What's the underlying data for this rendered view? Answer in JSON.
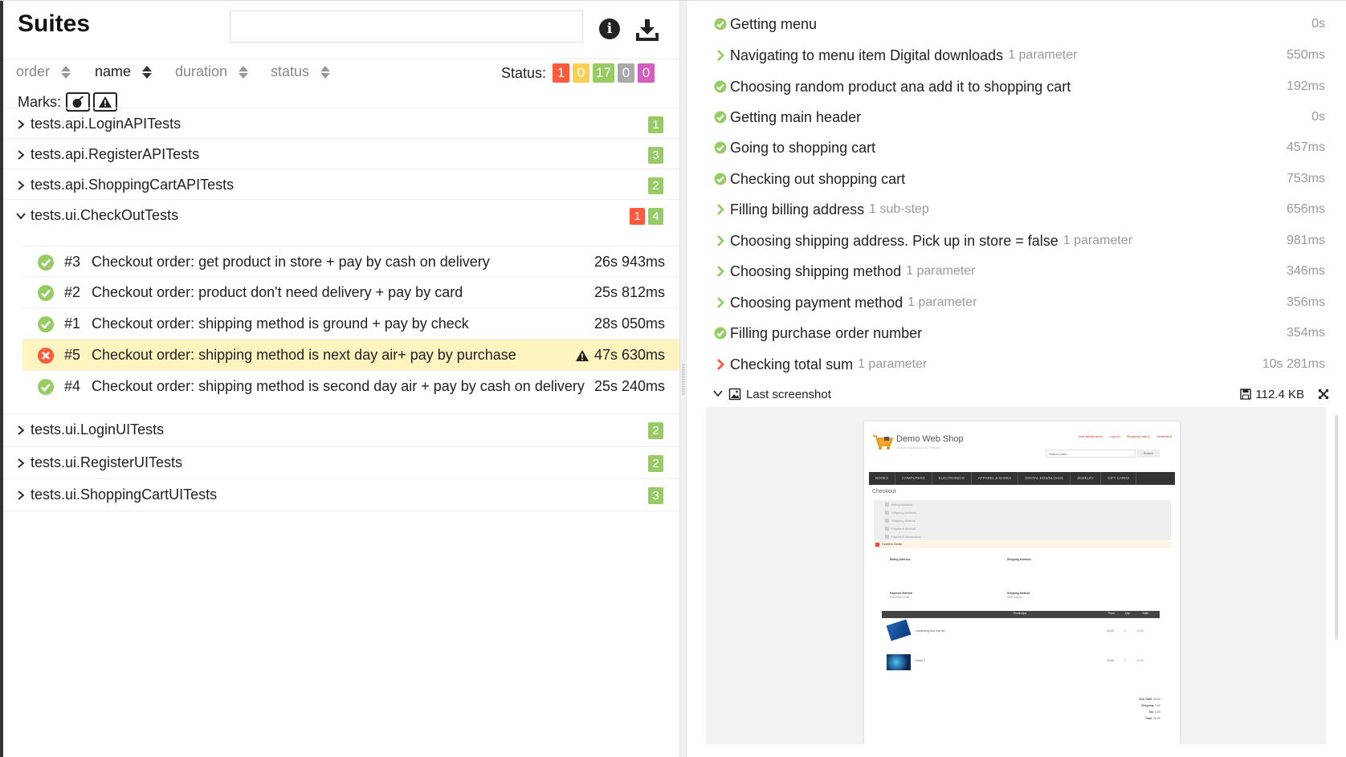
{
  "left": {
    "title": "Suites",
    "search": {
      "value": "",
      "placeholder": ""
    },
    "icons": {
      "info": "info-icon",
      "download": "download-icon"
    },
    "sort": [
      {
        "label": "order"
      },
      {
        "label": "name"
      },
      {
        "label": "duration"
      },
      {
        "label": "status"
      }
    ],
    "status_label": "Status:",
    "status_counts": [
      "1",
      "0",
      "17",
      "0",
      "0"
    ],
    "marks_label": "Marks:",
    "suites_before": [
      {
        "name": "tests.api.LoginAPITests",
        "passed": "1"
      },
      {
        "name": "tests.api.RegisterAPITests",
        "passed": "3"
      },
      {
        "name": "tests.api.ShoppingCartAPITests",
        "passed": "2"
      }
    ],
    "expanded_suite": {
      "name": "tests.ui.CheckOutTests",
      "failed": "1",
      "passed": "4"
    },
    "tests": [
      {
        "order": "#3",
        "name": "Checkout order: get product in store + pay by cash on delivery",
        "duration": "26s 943ms"
      },
      {
        "order": "#2",
        "name": "Checkout order: product don't need delivery + pay by card",
        "duration": "25s 812ms"
      },
      {
        "order": "#1",
        "name": "Checkout order: shipping method is ground + pay by check",
        "duration": "28s 050ms"
      },
      {
        "order": "#5",
        "name": "Checkout order: shipping method is next day air+ pay by purchase",
        "duration": "47s 630ms"
      },
      {
        "order": "#4",
        "name": "Checkout order: shipping method is second day air + pay by cash on delivery",
        "duration": "25s 240ms"
      }
    ],
    "suites_after": [
      {
        "name": "tests.ui.LoginUITests",
        "passed": "2"
      },
      {
        "name": "tests.ui.RegisterUITests",
        "passed": "2"
      },
      {
        "name": "tests.ui.ShoppingCartUITests",
        "passed": "3"
      }
    ]
  },
  "right": {
    "steps": [
      {
        "name": "Getting menu",
        "extra": "",
        "duration": "0s"
      },
      {
        "name": "Navigating to menu item Digital downloads",
        "extra": "1 parameter",
        "duration": "550ms"
      },
      {
        "name": "Choosing random product ana add it to shopping cart",
        "extra": "",
        "duration": "192ms"
      },
      {
        "name": "Getting main header",
        "extra": "",
        "duration": "0s"
      },
      {
        "name": "Going to shopping cart",
        "extra": "",
        "duration": "457ms"
      },
      {
        "name": "Checking out shopping cart",
        "extra": "",
        "duration": "753ms"
      },
      {
        "name": "Filling billing address",
        "extra": "1 sub-step",
        "duration": "656ms"
      },
      {
        "name": "Choosing shipping address. Pick up in store = false",
        "extra": "1 parameter",
        "duration": "981ms"
      },
      {
        "name": "Choosing shipping method",
        "extra": "1 parameter",
        "duration": "346ms"
      },
      {
        "name": "Choosing payment method",
        "extra": "1 parameter",
        "duration": "356ms"
      },
      {
        "name": "Filling purchase order number",
        "extra": "",
        "duration": "354ms"
      },
      {
        "name": "Checking total sum",
        "extra": "1 parameter",
        "duration": "10s 281ms"
      }
    ],
    "attachment": {
      "name": "Last screenshot",
      "size": "112.4 KB"
    },
    "screenshot": {
      "logo": "Demo Web Shop",
      "logo_sub": "Sample Application by Tricentis",
      "links": [
        "testuser@mail.ru",
        "Log out",
        "Shopping cart(1)",
        "Wishlist(0)"
      ],
      "search_placeholder": "Search store",
      "search_btn": "Search",
      "menu": [
        "BOOKS",
        "COMPUTERS",
        "ELECTRONICS",
        "APPAREL & SHOES",
        "DIGITAL DOWNLOADS",
        "JEWELRY",
        "GIFT CARDS"
      ],
      "page_title": "Checkout",
      "checkout_steps": [
        "Billing Address",
        "Shipping Address",
        "Shipping Method",
        "Payment Method",
        "Payment Information"
      ],
      "confirm_label": "Confirm Order",
      "billing_title": "Billing Address",
      "shipping_title": "Shipping Address",
      "payment_title": "Payment Method",
      "payment_value": "Purchase Order",
      "shipping_method_title": "Shipping Method",
      "shipping_method_value": "Next Day Air",
      "table_headers": [
        "Product(s)",
        "Price",
        "Qty.",
        "Total"
      ],
      "products": [
        {
          "name": "Computing and Internet",
          "price": "10.00",
          "qty": "1",
          "total": "10.00"
        },
        {
          "name": "Music 2",
          "price": "10.00",
          "qty": "1",
          "total": "10.00"
        }
      ],
      "totals": [
        {
          "label": "Sub-Total:",
          "value": "20.00"
        },
        {
          "label": "Shipping:",
          "value": "0.00"
        },
        {
          "label": "Tax:",
          "value": "0.00"
        },
        {
          "label": "Total:",
          "value": "20.00"
        }
      ]
    }
  },
  "colors": {
    "failed": "#fd5a3e",
    "broken": "#ffd050",
    "passed": "#97cc64",
    "skipped": "#aaaaaa",
    "unknown": "#d35ebe",
    "selected_row": "#fdf4c0"
  }
}
